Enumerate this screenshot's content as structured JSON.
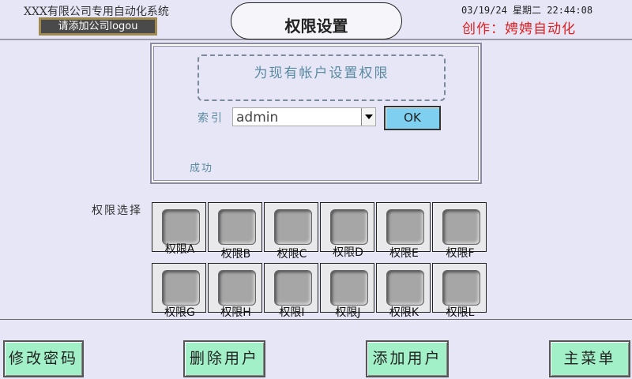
{
  "header": {
    "company_name": "XXX有限公司专用自动化系统",
    "logo_button_label": "请添加公司logou",
    "title": "权限设置",
    "datetime": "03/19/24 星期二 22:44:08",
    "author": "创作：娉娉自动化"
  },
  "panel": {
    "banner_text": "为现有帐户设置权限",
    "index_label": "索引",
    "user_select_value": "admin",
    "ok_label": "OK",
    "status_text": "成功"
  },
  "permissions": {
    "label": "权限选择",
    "items": [
      "权限A",
      "权限B",
      "权限C",
      "权限D",
      "权限E",
      "权限F",
      "权限G",
      "权限H",
      "权限I",
      "权限J",
      "权限K",
      "权限L"
    ]
  },
  "bottom_menu": {
    "change_password": "修改密码",
    "delete_user": "删除用户",
    "add_user": "添加用户",
    "main_menu": "主菜单"
  },
  "colors": {
    "background": "#e6e6f6",
    "ok_button": "#7fd0f0",
    "bottom_buttons": "#a2f0c8",
    "author_text": "#e02020",
    "panel_text": "#5a8aa0"
  }
}
